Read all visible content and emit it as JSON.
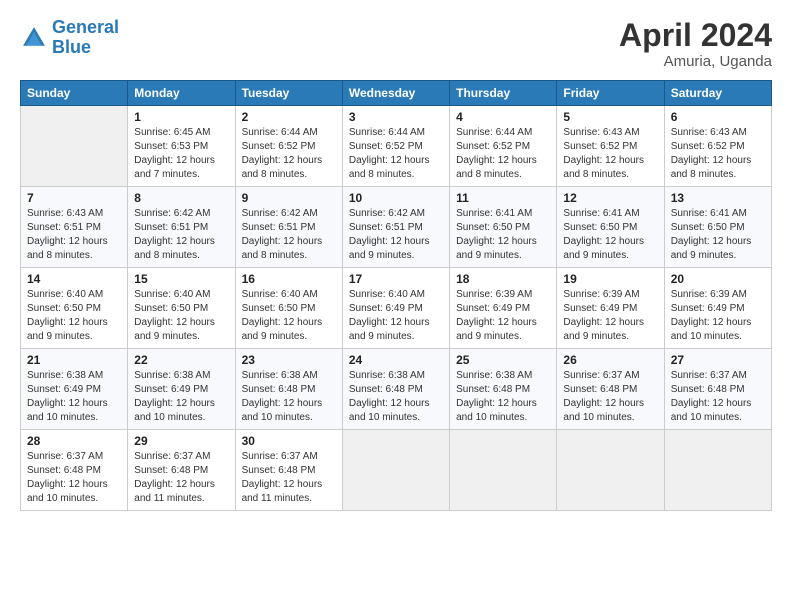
{
  "logo": {
    "text_general": "General",
    "text_blue": "Blue"
  },
  "header": {
    "month_year": "April 2024",
    "location": "Amuria, Uganda"
  },
  "days_of_week": [
    "Sunday",
    "Monday",
    "Tuesday",
    "Wednesday",
    "Thursday",
    "Friday",
    "Saturday"
  ],
  "weeks": [
    [
      {
        "day": "",
        "info": ""
      },
      {
        "day": "1",
        "info": "Sunrise: 6:45 AM\nSunset: 6:53 PM\nDaylight: 12 hours\nand 7 minutes."
      },
      {
        "day": "2",
        "info": "Sunrise: 6:44 AM\nSunset: 6:52 PM\nDaylight: 12 hours\nand 8 minutes."
      },
      {
        "day": "3",
        "info": "Sunrise: 6:44 AM\nSunset: 6:52 PM\nDaylight: 12 hours\nand 8 minutes."
      },
      {
        "day": "4",
        "info": "Sunrise: 6:44 AM\nSunset: 6:52 PM\nDaylight: 12 hours\nand 8 minutes."
      },
      {
        "day": "5",
        "info": "Sunrise: 6:43 AM\nSunset: 6:52 PM\nDaylight: 12 hours\nand 8 minutes."
      },
      {
        "day": "6",
        "info": "Sunrise: 6:43 AM\nSunset: 6:52 PM\nDaylight: 12 hours\nand 8 minutes."
      }
    ],
    [
      {
        "day": "7",
        "info": "Sunrise: 6:43 AM\nSunset: 6:51 PM\nDaylight: 12 hours\nand 8 minutes."
      },
      {
        "day": "8",
        "info": "Sunrise: 6:42 AM\nSunset: 6:51 PM\nDaylight: 12 hours\nand 8 minutes."
      },
      {
        "day": "9",
        "info": "Sunrise: 6:42 AM\nSunset: 6:51 PM\nDaylight: 12 hours\nand 8 minutes."
      },
      {
        "day": "10",
        "info": "Sunrise: 6:42 AM\nSunset: 6:51 PM\nDaylight: 12 hours\nand 9 minutes."
      },
      {
        "day": "11",
        "info": "Sunrise: 6:41 AM\nSunset: 6:50 PM\nDaylight: 12 hours\nand 9 minutes."
      },
      {
        "day": "12",
        "info": "Sunrise: 6:41 AM\nSunset: 6:50 PM\nDaylight: 12 hours\nand 9 minutes."
      },
      {
        "day": "13",
        "info": "Sunrise: 6:41 AM\nSunset: 6:50 PM\nDaylight: 12 hours\nand 9 minutes."
      }
    ],
    [
      {
        "day": "14",
        "info": "Sunrise: 6:40 AM\nSunset: 6:50 PM\nDaylight: 12 hours\nand 9 minutes."
      },
      {
        "day": "15",
        "info": "Sunrise: 6:40 AM\nSunset: 6:50 PM\nDaylight: 12 hours\nand 9 minutes."
      },
      {
        "day": "16",
        "info": "Sunrise: 6:40 AM\nSunset: 6:50 PM\nDaylight: 12 hours\nand 9 minutes."
      },
      {
        "day": "17",
        "info": "Sunrise: 6:40 AM\nSunset: 6:49 PM\nDaylight: 12 hours\nand 9 minutes."
      },
      {
        "day": "18",
        "info": "Sunrise: 6:39 AM\nSunset: 6:49 PM\nDaylight: 12 hours\nand 9 minutes."
      },
      {
        "day": "19",
        "info": "Sunrise: 6:39 AM\nSunset: 6:49 PM\nDaylight: 12 hours\nand 9 minutes."
      },
      {
        "day": "20",
        "info": "Sunrise: 6:39 AM\nSunset: 6:49 PM\nDaylight: 12 hours\nand 10 minutes."
      }
    ],
    [
      {
        "day": "21",
        "info": "Sunrise: 6:38 AM\nSunset: 6:49 PM\nDaylight: 12 hours\nand 10 minutes."
      },
      {
        "day": "22",
        "info": "Sunrise: 6:38 AM\nSunset: 6:49 PM\nDaylight: 12 hours\nand 10 minutes."
      },
      {
        "day": "23",
        "info": "Sunrise: 6:38 AM\nSunset: 6:48 PM\nDaylight: 12 hours\nand 10 minutes."
      },
      {
        "day": "24",
        "info": "Sunrise: 6:38 AM\nSunset: 6:48 PM\nDaylight: 12 hours\nand 10 minutes."
      },
      {
        "day": "25",
        "info": "Sunrise: 6:38 AM\nSunset: 6:48 PM\nDaylight: 12 hours\nand 10 minutes."
      },
      {
        "day": "26",
        "info": "Sunrise: 6:37 AM\nSunset: 6:48 PM\nDaylight: 12 hours\nand 10 minutes."
      },
      {
        "day": "27",
        "info": "Sunrise: 6:37 AM\nSunset: 6:48 PM\nDaylight: 12 hours\nand 10 minutes."
      }
    ],
    [
      {
        "day": "28",
        "info": "Sunrise: 6:37 AM\nSunset: 6:48 PM\nDaylight: 12 hours\nand 10 minutes."
      },
      {
        "day": "29",
        "info": "Sunrise: 6:37 AM\nSunset: 6:48 PM\nDaylight: 12 hours\nand 11 minutes."
      },
      {
        "day": "30",
        "info": "Sunrise: 6:37 AM\nSunset: 6:48 PM\nDaylight: 12 hours\nand 11 minutes."
      },
      {
        "day": "",
        "info": ""
      },
      {
        "day": "",
        "info": ""
      },
      {
        "day": "",
        "info": ""
      },
      {
        "day": "",
        "info": ""
      }
    ]
  ]
}
